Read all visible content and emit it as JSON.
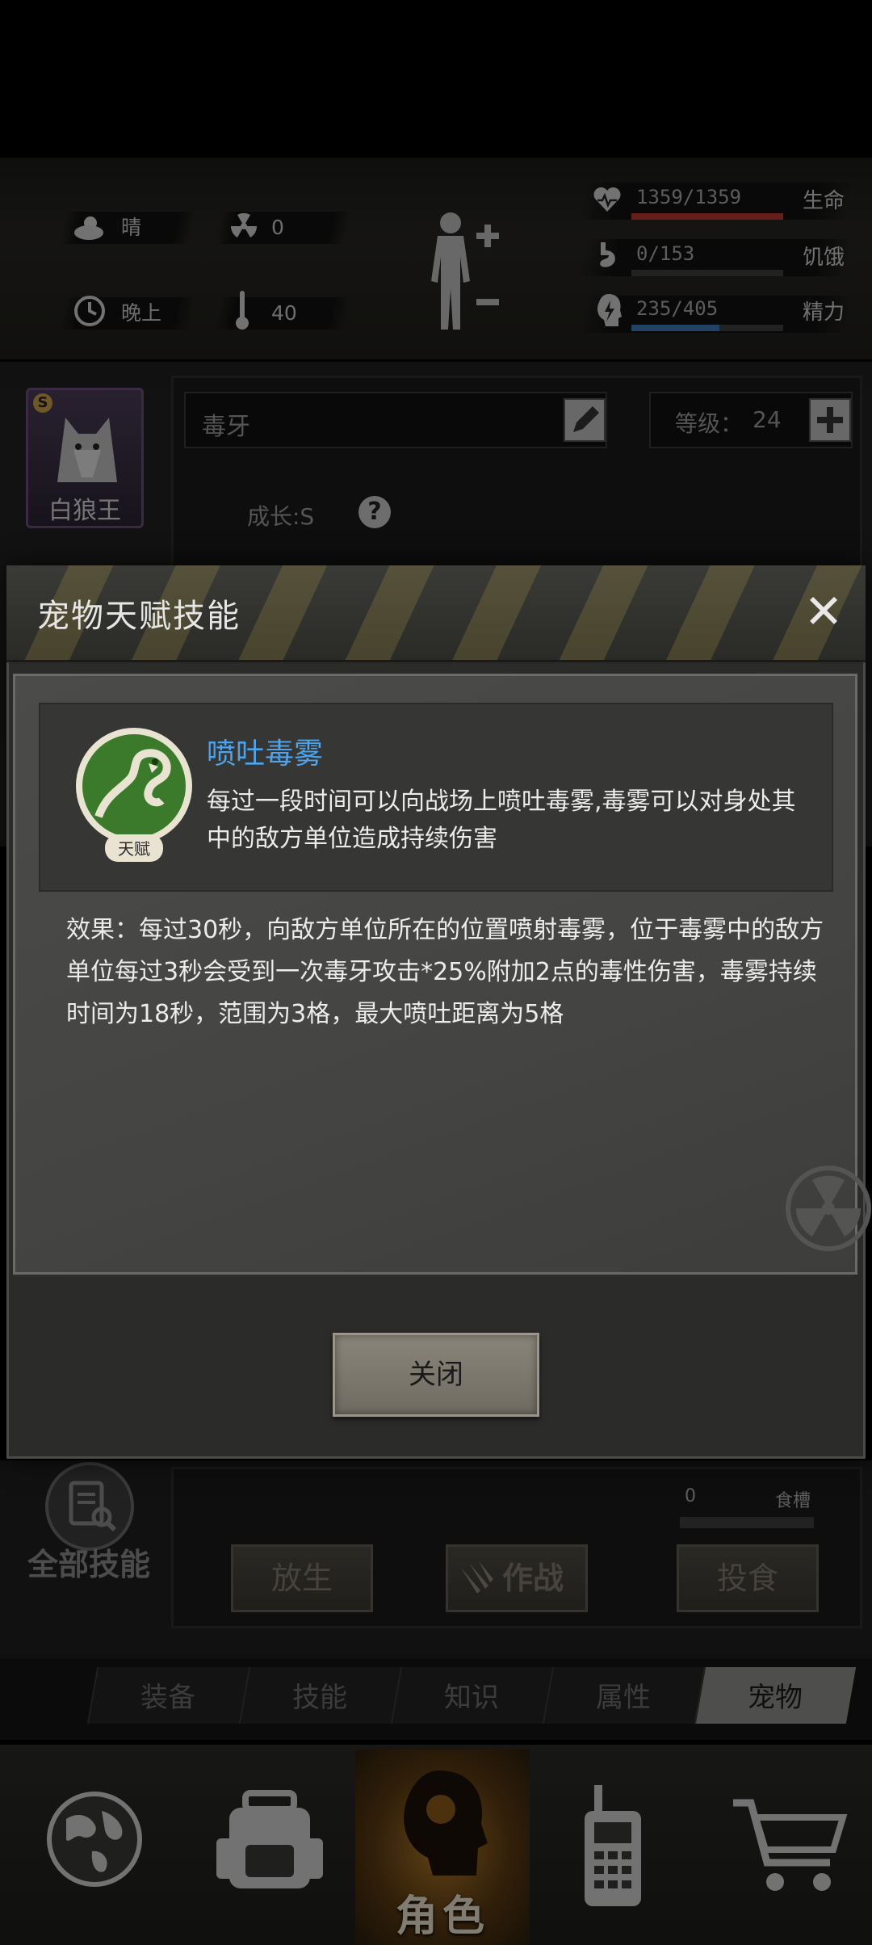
{
  "status": {
    "weather": "晴",
    "radiation": "0",
    "time_of_day": "晚上",
    "temperature": "40",
    "health": {
      "value": "1359/1359",
      "label": "生命",
      "fraction": 1.0,
      "color": "#b8382f"
    },
    "hunger": {
      "value": "0/153",
      "label": "饥饿",
      "fraction": 0.0,
      "color": "#b07a2a"
    },
    "energy": {
      "value": "235/405",
      "label": "精力",
      "fraction": 0.58,
      "color": "#3d78b5"
    }
  },
  "pet": {
    "name": "白狼王",
    "grade_badge": "S",
    "nickname": "毒牙",
    "level_label": "等级：",
    "level": "24",
    "growth": "成长:S",
    "help_glyph": "?"
  },
  "modal": {
    "title": "宠物天赋技能",
    "close_glyph": "✕",
    "skill": {
      "badge": "天赋",
      "name": "喷吐毒雾",
      "description": "每过一段时间可以向战场上喷吐毒雾,毒雾可以对身处其中的敌方单位造成持续伤害"
    },
    "effect": "效果：每过30秒，向敌方单位所在的位置喷射毒雾，位于毒雾中的敌方单位每过3秒会受到一次毒牙攻击*25%附加2点的毒性伤害，毒雾持续时间为18秒，范围为3格，最大喷吐距离为5格",
    "close_button": "关闭"
  },
  "pet_controls": {
    "all_skills": "全部技能",
    "food_count": "0",
    "food_label": "食槽",
    "release": "放生",
    "battle": "作战",
    "feed": "投食"
  },
  "tabs": [
    {
      "label": "装备",
      "active": false
    },
    {
      "label": "技能",
      "active": false
    },
    {
      "label": "知识",
      "active": false
    },
    {
      "label": "属性",
      "active": false
    },
    {
      "label": "宠物",
      "active": true
    }
  ],
  "bottom_nav": {
    "character_label": "角色"
  },
  "colors": {
    "skill_name": "#4fa3ea",
    "hazard_stripe": "#e6c850"
  }
}
